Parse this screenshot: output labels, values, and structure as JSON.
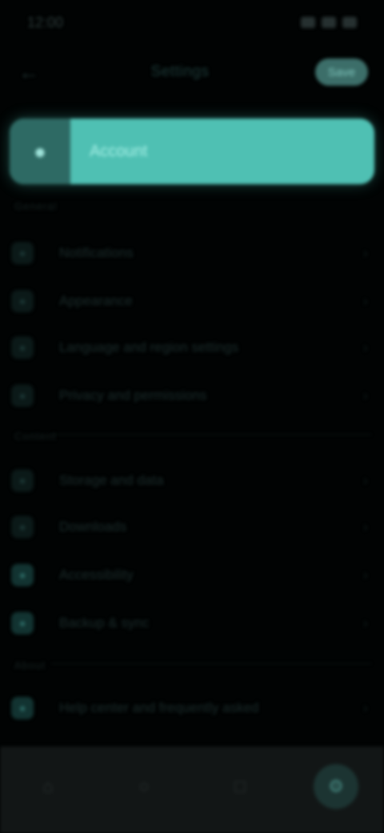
{
  "status_bar": {
    "time": "12:00"
  },
  "header": {
    "back_icon": "arrow-left-icon",
    "title": "Settings",
    "action_label": "Save"
  },
  "hero": {
    "avatar_icon": "profile-icon",
    "label": "Account"
  },
  "sections": [
    {
      "label": "General",
      "items": [
        {
          "label": "Notifications",
          "icon": "bell-icon"
        },
        {
          "label": "Appearance",
          "icon": "palette-icon"
        },
        {
          "label": "Language and region settings",
          "icon": "globe-icon"
        },
        {
          "label": "Privacy and permissions",
          "icon": "lock-icon"
        }
      ]
    },
    {
      "label": "Content",
      "items": [
        {
          "label": "Storage and data",
          "icon": "storage-icon"
        },
        {
          "label": "Downloads",
          "icon": "download-icon"
        },
        {
          "label": "Accessibility",
          "icon": "accessibility-icon"
        },
        {
          "label": "Backup & sync",
          "icon": "cloud-icon"
        }
      ]
    },
    {
      "label": "About",
      "items": [
        {
          "label": "Help center and frequently asked",
          "icon": "help-icon"
        }
      ]
    }
  ],
  "bottom_nav": [
    {
      "name": "home",
      "icon": "home-icon"
    },
    {
      "name": "search",
      "icon": "search-icon"
    },
    {
      "name": "library",
      "icon": "library-icon"
    },
    {
      "name": "settings",
      "icon": "settings-icon"
    }
  ],
  "colors": {
    "background": "#010303",
    "accent": "#4fc0b3",
    "nav_background": "#121616"
  }
}
